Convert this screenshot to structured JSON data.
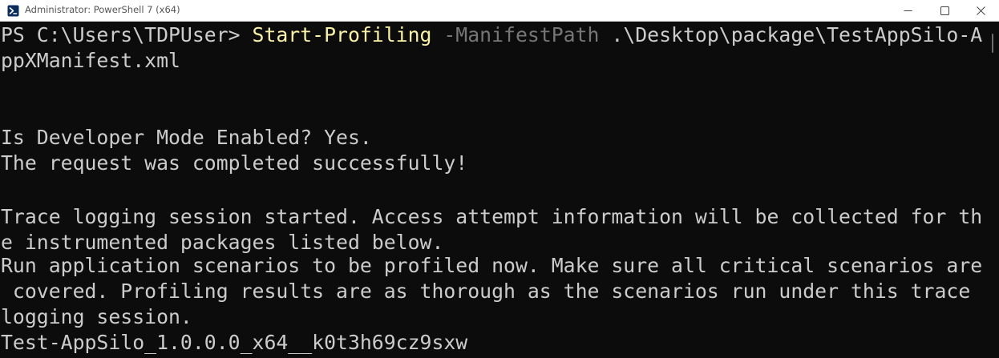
{
  "window": {
    "title": "Administrator: PowerShell 7 (x64)",
    "icon": "powershell-icon",
    "controls": [
      "minimize-icon",
      "maximize-icon",
      "close-icon"
    ]
  },
  "terminal": {
    "prompt": "PS C:\\Users\\TDPUser> ",
    "command": "Start-Profiling",
    "parameter": " -ManifestPath",
    "argument_part1": " .\\Desktop\\package\\TestAppSilo-A",
    "argument_part2": "ppXManifest.xml",
    "output": [
      "Is Developer Mode Enabled? Yes.",
      "The request was completed successfully!",
      "Trace logging session started. Access attempt information will be collected for th",
      "e instrumented packages listed below.",
      "Run application scenarios to be profiled now. Make sure all critical scenarios are",
      " covered. Profiling results are as thorough as the scenarios run under this trace",
      "logging session.",
      "Test-AppSilo_1.0.0.0_x64__k0t3h69cz9sxw"
    ]
  },
  "colors": {
    "background": "#0c0c0c",
    "text": "#cccccc",
    "command": "#f9f1a5",
    "parameter": "#767676"
  }
}
